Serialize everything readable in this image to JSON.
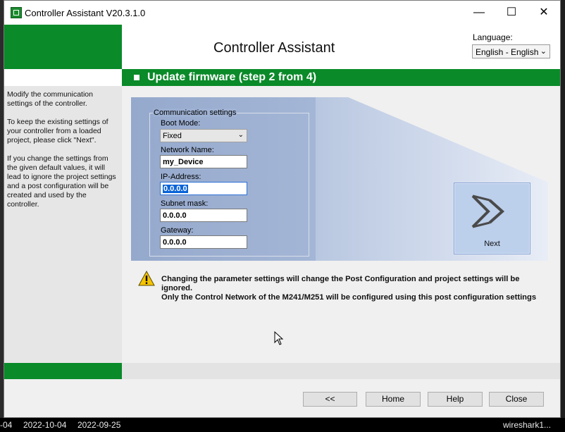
{
  "window": {
    "title": "Controller Assistant V20.3.1.0",
    "minimize": "—",
    "maximize": "☐",
    "close": "✕"
  },
  "header": {
    "app_title": "Controller Assistant",
    "language_label": "Language:",
    "language_value": "English - English"
  },
  "step": {
    "title": "Update firmware (step 2 from 4)"
  },
  "sidebar": {
    "p1": "Modify the communication settings of the controller.",
    "p2": "To keep the existing settings of your controller from a loaded project, please click \"Next\".",
    "p3": "If you change the settings from the given default values, it will lead to ignore the project settings and a post configuration will be created and used by the controller."
  },
  "comm": {
    "group_label": "Communication settings",
    "boot_mode_label": "Boot Mode:",
    "boot_mode_value": "Fixed",
    "network_name_label": "Network Name:",
    "network_name_value": "my_Device",
    "ip_label": "IP-Address:",
    "ip_value": "0.0.0.0",
    "subnet_label": "Subnet mask:",
    "subnet_value": "0.0.0.0",
    "gateway_label": "Gateway:",
    "gateway_value": "0.0.0.0"
  },
  "next_button": {
    "label": "Next"
  },
  "warning": {
    "line1": "Changing the parameter settings will change the Post Configuration and project settings will be ignored.",
    "line2": "Only the Control Network of the M241/M251 will be configured using this post configuration settings"
  },
  "footer": {
    "back": "<<",
    "home": "Home",
    "help": "Help",
    "close": "Close"
  },
  "taskbar": {
    "t1": "-04",
    "t2": "2022-10-04",
    "t3": "2022-09-25",
    "t4": "wireshark1..."
  },
  "colors": {
    "brand_green": "#0a8a29",
    "panel_blue": "#a4b6d6",
    "selection_blue": "#0a64d8"
  }
}
